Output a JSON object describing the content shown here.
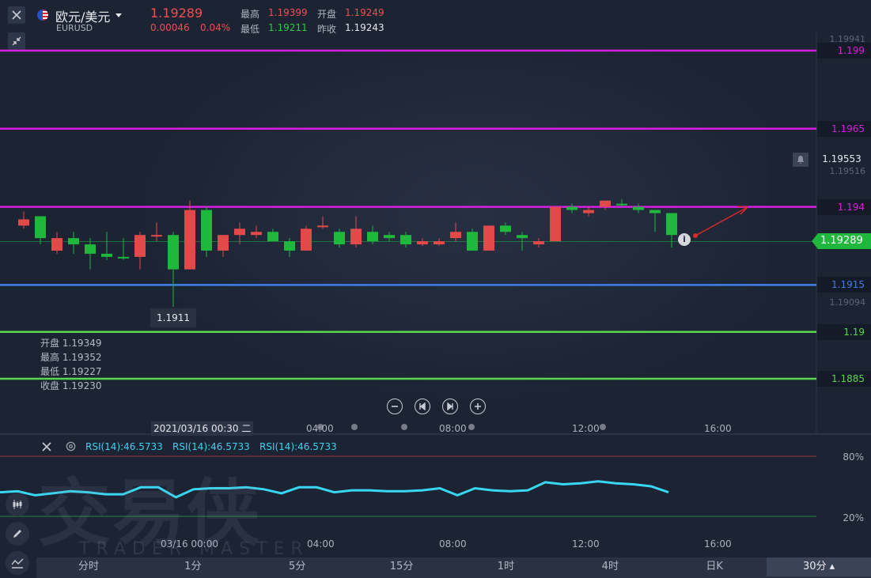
{
  "header": {
    "pair": "欧元/美元",
    "symbol": "EURUSD",
    "price": "1.19289",
    "change": "0.00046",
    "change_pct": "0.04%",
    "stats": [
      {
        "label": "最高",
        "value": "1.19399",
        "color": "#ef4f4f"
      },
      {
        "label": "开盘",
        "value": "1.19249",
        "color": "#ef4f4f"
      },
      {
        "label": "最低",
        "value": "1.19211",
        "color": "#2ecc40"
      },
      {
        "label": "昨收",
        "value": "1.19243",
        "color": "#e6e8ec"
      }
    ],
    "close_icon": "close-icon",
    "collapse_icon": "compress-icon",
    "flag_icon": "eu-us-flag-icon"
  },
  "levels": [
    {
      "value": 1.199,
      "label": "1.199",
      "color": "#d81ee0"
    },
    {
      "value": 1.1965,
      "label": "1.1965",
      "color": "#d81ee0"
    },
    {
      "value": 1.194,
      "label": "1.194",
      "color": "#d81ee0"
    },
    {
      "value": 1.1915,
      "label": "1.1915",
      "color": "#3f7fe8"
    },
    {
      "value": 1.19,
      "label": "1.19",
      "color": "#58d84c"
    },
    {
      "value": 1.1885,
      "label": "1.1885",
      "color": "#58d84c"
    }
  ],
  "price_axis": {
    "top": "1.19941",
    "mid_high": "1.19516",
    "mid_low": "1.19094",
    "alert_price": "1.19553",
    "current": "1.19289",
    "current_color": "#1fb73c"
  },
  "low_marker": "1.1911",
  "ohlc": [
    {
      "label": "开盘",
      "value": "1.19349"
    },
    {
      "label": "最高",
      "value": "1.19352"
    },
    {
      "label": "最低",
      "value": "1.19227"
    },
    {
      "label": "收盘",
      "value": "1.19230"
    }
  ],
  "time_axis": {
    "cursor": "2021/03/16 00:30 二",
    "ticks": [
      "04:00",
      "08:00",
      "12:00",
      "16:00"
    ]
  },
  "rsi": {
    "labels": [
      "RSI(14):46.5733",
      "RSI(14):46.5733",
      "RSI(14):46.5733"
    ],
    "upper": "80%",
    "lower": "20%",
    "color": "#38d6f0",
    "values": [
      44,
      45,
      41,
      43,
      45,
      44,
      42,
      42,
      49,
      49,
      39,
      47,
      48,
      48,
      49,
      47,
      43,
      49,
      49,
      44,
      46,
      46,
      45,
      45,
      46,
      48,
      41,
      48,
      46,
      45,
      46,
      54,
      52,
      53,
      55,
      53,
      52,
      50,
      44
    ],
    "ticks": [
      "03/16 00:00",
      "04:00",
      "08:00",
      "12:00",
      "16:00"
    ]
  },
  "watermark": {
    "cn": "交易侠",
    "en": "TRADER MASTER"
  },
  "timeframes": [
    {
      "label": "分时",
      "active": false
    },
    {
      "label": "1分",
      "active": false
    },
    {
      "label": "5分",
      "active": false
    },
    {
      "label": "15分",
      "active": false
    },
    {
      "label": "1时",
      "active": false
    },
    {
      "label": "4时",
      "active": false
    },
    {
      "label": "日K",
      "active": false
    },
    {
      "label": "30分",
      "active": true
    }
  ],
  "chart_data": {
    "type": "candlestick",
    "ylim": [
      1.1885,
      1.19941
    ],
    "candles": [
      {
        "o": 1.1936,
        "h": 1.19385,
        "l": 1.1933,
        "c": 1.1934,
        "up": false
      },
      {
        "o": 1.193,
        "h": 1.1937,
        "l": 1.1928,
        "c": 1.1937,
        "up": true
      },
      {
        "o": 1.1926,
        "h": 1.1932,
        "l": 1.1925,
        "c": 1.193,
        "up": false
      },
      {
        "o": 1.193,
        "h": 1.1932,
        "l": 1.1925,
        "c": 1.1928,
        "up": true
      },
      {
        "o": 1.1928,
        "h": 1.193,
        "l": 1.192,
        "c": 1.1925,
        "up": true
      },
      {
        "o": 1.1924,
        "h": 1.1932,
        "l": 1.1923,
        "c": 1.1925,
        "up": true
      },
      {
        "o": 1.1924,
        "h": 1.193,
        "l": 1.1923,
        "c": 1.1924,
        "up": true
      },
      {
        "o": 1.1924,
        "h": 1.1932,
        "l": 1.192,
        "c": 1.1931,
        "up": false
      },
      {
        "o": 1.1931,
        "h": 1.1935,
        "l": 1.1929,
        "c": 1.1931,
        "up": false
      },
      {
        "o": 1.1931,
        "h": 1.1932,
        "l": 1.1915,
        "c": 1.192,
        "up": true
      },
      {
        "o": 1.192,
        "h": 1.1942,
        "l": 1.192,
        "c": 1.1939,
        "up": false
      },
      {
        "o": 1.1939,
        "h": 1.194,
        "l": 1.1924,
        "c": 1.1926,
        "up": true
      },
      {
        "o": 1.1926,
        "h": 1.193,
        "l": 1.1924,
        "c": 1.1931,
        "up": false
      },
      {
        "o": 1.1931,
        "h": 1.1935,
        "l": 1.1928,
        "c": 1.1933,
        "up": false
      },
      {
        "o": 1.1932,
        "h": 1.1934,
        "l": 1.193,
        "c": 1.1931,
        "up": false
      },
      {
        "o": 1.1932,
        "h": 1.1933,
        "l": 1.1929,
        "c": 1.1929,
        "up": true
      },
      {
        "o": 1.1929,
        "h": 1.193,
        "l": 1.1924,
        "c": 1.1926,
        "up": true
      },
      {
        "o": 1.1926,
        "h": 1.1934,
        "l": 1.1926,
        "c": 1.1933,
        "up": false
      },
      {
        "o": 1.1934,
        "h": 1.1937,
        "l": 1.1933,
        "c": 1.1934,
        "up": false
      },
      {
        "o": 1.1932,
        "h": 1.1933,
        "l": 1.1927,
        "c": 1.1928,
        "up": true
      },
      {
        "o": 1.1928,
        "h": 1.1937,
        "l": 1.1927,
        "c": 1.1933,
        "up": false
      },
      {
        "o": 1.1932,
        "h": 1.1934,
        "l": 1.1928,
        "c": 1.1929,
        "up": true
      },
      {
        "o": 1.193,
        "h": 1.1932,
        "l": 1.1929,
        "c": 1.1931,
        "up": true
      },
      {
        "o": 1.1931,
        "h": 1.1932,
        "l": 1.1927,
        "c": 1.1928,
        "up": true
      },
      {
        "o": 1.1928,
        "h": 1.193,
        "l": 1.19275,
        "c": 1.1929,
        "up": false
      },
      {
        "o": 1.1928,
        "h": 1.193,
        "l": 1.19275,
        "c": 1.1929,
        "up": false
      },
      {
        "o": 1.193,
        "h": 1.1935,
        "l": 1.1929,
        "c": 1.1932,
        "up": false
      },
      {
        "o": 1.1932,
        "h": 1.1933,
        "l": 1.1926,
        "c": 1.1926,
        "up": true
      },
      {
        "o": 1.1926,
        "h": 1.1934,
        "l": 1.1926,
        "c": 1.1934,
        "up": false
      },
      {
        "o": 1.1932,
        "h": 1.1935,
        "l": 1.1931,
        "c": 1.1934,
        "up": true
      },
      {
        "o": 1.193,
        "h": 1.1932,
        "l": 1.1926,
        "c": 1.1931,
        "up": true
      },
      {
        "o": 1.1928,
        "h": 1.193,
        "l": 1.1927,
        "c": 1.1929,
        "up": false
      },
      {
        "o": 1.1929,
        "h": 1.194,
        "l": 1.1929,
        "c": 1.194,
        "up": false
      },
      {
        "o": 1.194,
        "h": 1.1941,
        "l": 1.1938,
        "c": 1.1939,
        "up": true
      },
      {
        "o": 1.1938,
        "h": 1.194,
        "l": 1.1937,
        "c": 1.1939,
        "up": false
      },
      {
        "o": 1.194,
        "h": 1.1942,
        "l": 1.1939,
        "c": 1.1942,
        "up": false
      },
      {
        "o": 1.1941,
        "h": 1.19425,
        "l": 1.194,
        "c": 1.1941,
        "up": true
      },
      {
        "o": 1.194,
        "h": 1.1941,
        "l": 1.1938,
        "c": 1.1939,
        "up": true
      },
      {
        "o": 1.1938,
        "h": 1.1939,
        "l": 1.1932,
        "c": 1.1939,
        "up": true
      },
      {
        "o": 1.1938,
        "h": 1.1938,
        "l": 1.1927,
        "c": 1.1931,
        "up": true
      }
    ],
    "up_color": "#1fb73c",
    "down_color": "#e24a4a"
  }
}
